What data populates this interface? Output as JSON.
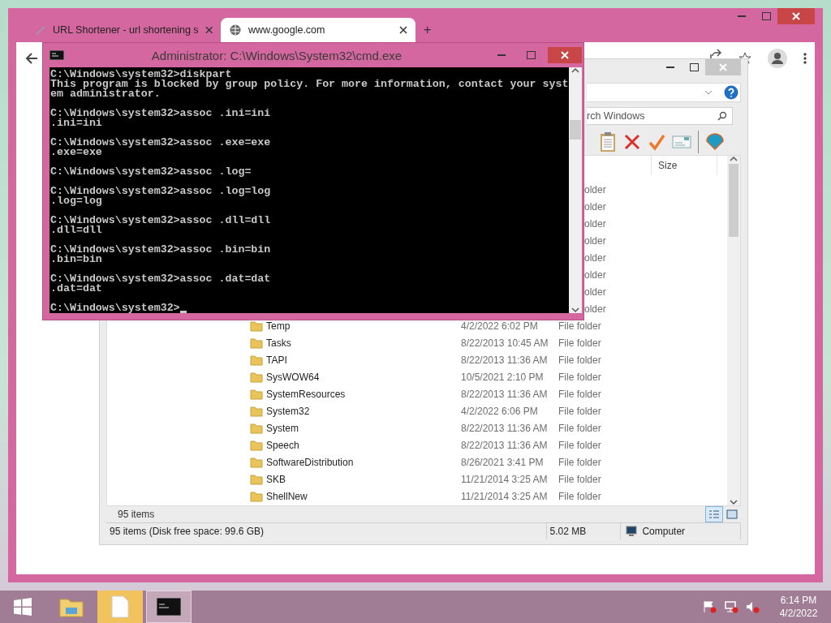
{
  "browser": {
    "tabs": [
      {
        "title": "URL Shortener - url shortening s",
        "selected": false
      },
      {
        "title": "www.google.com",
        "selected": true
      }
    ],
    "new_tab": "+"
  },
  "explorer": {
    "search": {
      "value": "rch Windows"
    },
    "columns": {
      "size": "Size"
    },
    "rows": [
      {
        "kind": "covered",
        "type": "older"
      },
      {
        "kind": "covered",
        "type": "older"
      },
      {
        "kind": "covered",
        "type": "older"
      },
      {
        "kind": "covered",
        "type": "older"
      },
      {
        "kind": "covered",
        "type": "older"
      },
      {
        "kind": "covered",
        "type": "older"
      },
      {
        "kind": "covered",
        "type": "older"
      },
      {
        "kind": "covered",
        "type": "older"
      },
      {
        "kind": "folder",
        "name": "Temp",
        "date": "4/2/2022 6:02 PM",
        "type": "File folder"
      },
      {
        "kind": "folder",
        "name": "Tasks",
        "date": "8/22/2013 10:45 AM",
        "type": "File folder"
      },
      {
        "kind": "folder",
        "name": "TAPI",
        "date": "8/22/2013 11:36 AM",
        "type": "File folder"
      },
      {
        "kind": "folder",
        "name": "SysWOW64",
        "date": "10/5/2021 2:10 PM",
        "type": "File folder"
      },
      {
        "kind": "folder",
        "name": "SystemResources",
        "date": "8/22/2013 11:36 AM",
        "type": "File folder"
      },
      {
        "kind": "folder",
        "name": "System32",
        "date": "4/2/2022 6:06 PM",
        "type": "File folder"
      },
      {
        "kind": "folder",
        "name": "System",
        "date": "8/22/2013 11:36 AM",
        "type": "File folder"
      },
      {
        "kind": "folder",
        "name": "Speech",
        "date": "8/22/2013 11:36 AM",
        "type": "File folder"
      },
      {
        "kind": "folder",
        "name": "SoftwareDistribution",
        "date": "8/26/2021 3:41 PM",
        "type": "File folder"
      },
      {
        "kind": "folder",
        "name": "SKB",
        "date": "11/21/2014 3:25 AM",
        "type": "File folder"
      },
      {
        "kind": "folder",
        "name": "ShellNew",
        "date": "11/21/2014 3:25 AM",
        "type": "File folder"
      }
    ],
    "item_count": "95 items",
    "views": [
      {
        "kind": "details",
        "selected": true
      },
      {
        "kind": "tiles",
        "selected": false
      }
    ],
    "status_bar": {
      "info": "95 items (Disk free space: 99.6 GB)",
      "size": "5.02 MB",
      "location": "Computer"
    }
  },
  "console": {
    "title": "Administrator: C:\\Windows\\System32\\cmd.exe",
    "blocks": [
      [
        "C:\\Windows\\system32>diskpart",
        "This program is blocked by group policy. For more information, contact your syst",
        "em administrator."
      ],
      [
        "C:\\Windows\\system32>assoc .ini=ini",
        ".ini=ini"
      ],
      [
        "C:\\Windows\\system32>assoc .exe=exe",
        ".exe=exe"
      ],
      [
        "C:\\Windows\\system32>assoc .log="
      ],
      [
        "C:\\Windows\\system32>assoc .log=log",
        ".log=log"
      ],
      [
        "C:\\Windows\\system32>assoc .dll=dll",
        ".dll=dll"
      ],
      [
        "C:\\Windows\\system32>assoc .bin=bin",
        ".bin=bin"
      ],
      [
        "C:\\Windows\\system32>assoc .dat=dat",
        ".dat=dat"
      ]
    ],
    "prompt": "C:\\Windows\\system32>"
  },
  "taskbar": {
    "buttons": [
      {
        "kind": "explorer",
        "selected": false,
        "flashing": false
      },
      {
        "kind": "file",
        "selected": false,
        "flashing": true
      },
      {
        "kind": "console",
        "selected": true,
        "flashing": false
      }
    ],
    "time": "6:14 PM",
    "date": "4/2/2022"
  }
}
